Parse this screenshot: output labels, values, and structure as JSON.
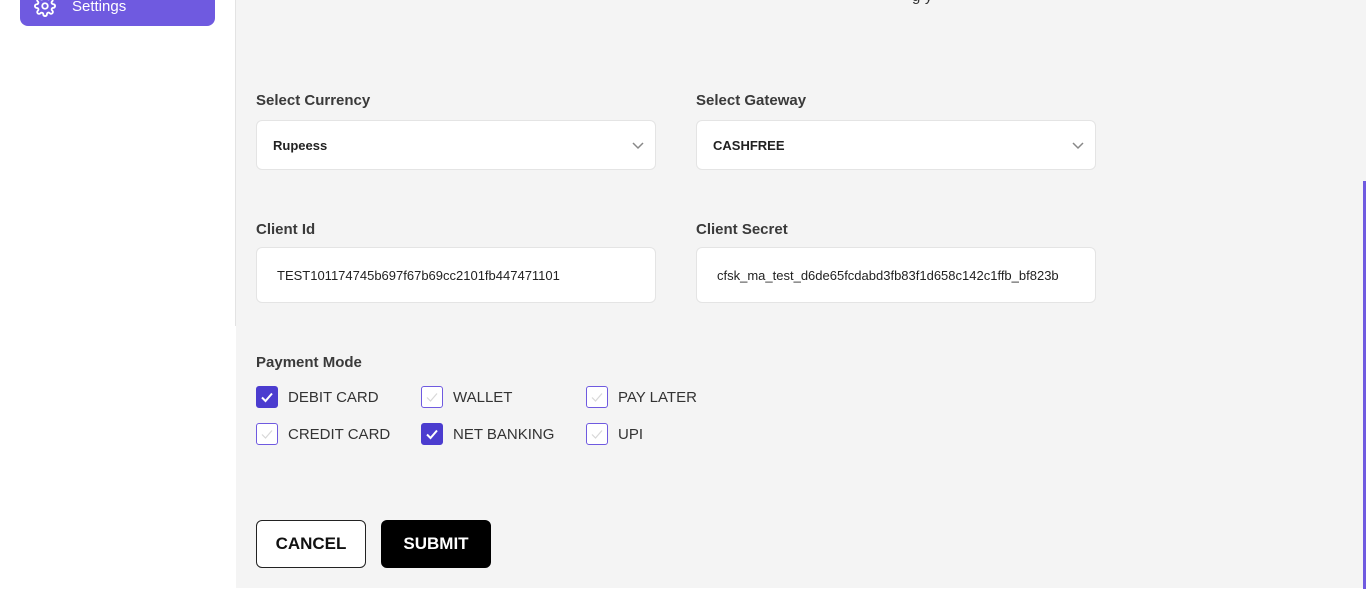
{
  "sidebar": {
    "settings_label": "Settings",
    "settings_icon": "gear-icon"
  },
  "header": {
    "partial_text": "g                                   y"
  },
  "form": {
    "currency": {
      "label": "Select Currency",
      "value": "Rupeess"
    },
    "gateway": {
      "label": "Select Gateway",
      "value": "CASHFREE"
    },
    "client_id": {
      "label": "Client Id",
      "value": "TEST101174745b697f67b69cc2101fb447471101"
    },
    "client_secret": {
      "label": "Client Secret",
      "value": "cfsk_ma_test_d6de65fcdabd3fb83f1d658c142c1ffb_bf823b"
    },
    "payment_mode": {
      "label": "Payment Mode",
      "options": [
        {
          "label": "DEBIT CARD",
          "checked": true
        },
        {
          "label": "WALLET",
          "checked": false
        },
        {
          "label": "PAY LATER",
          "checked": false
        },
        {
          "label": "CREDIT CARD",
          "checked": false
        },
        {
          "label": "NET BANKING",
          "checked": true
        },
        {
          "label": "UPI",
          "checked": false
        }
      ]
    }
  },
  "actions": {
    "cancel_label": "CANCEL",
    "submit_label": "SUBMIT"
  },
  "colors": {
    "accent": "#6f5ae0",
    "checked": "#4b3ccf",
    "background": "#f4f4f4"
  }
}
